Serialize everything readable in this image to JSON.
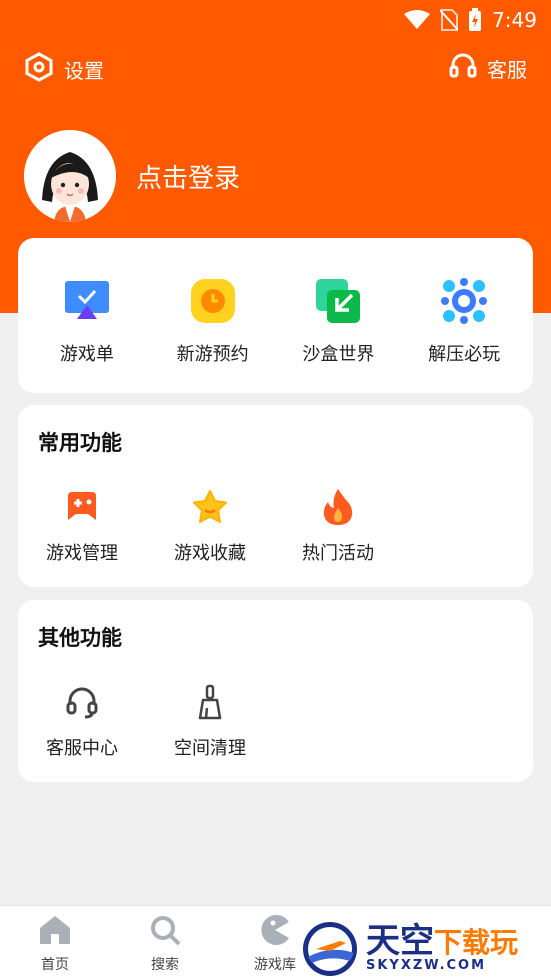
{
  "status_bar": {
    "time": "7:49"
  },
  "top": {
    "settings_label": "设置",
    "service_label": "客服"
  },
  "profile": {
    "login_label": "点击登录"
  },
  "quick_items": [
    {
      "label": "游戏单",
      "icon": "playlist-icon"
    },
    {
      "label": "新游预约",
      "icon": "clock-icon"
    },
    {
      "label": "沙盒世界",
      "icon": "sandbox-icon"
    },
    {
      "label": "解压必玩",
      "icon": "cluster-icon"
    }
  ],
  "common": {
    "title": "常用功能",
    "items": [
      {
        "label": "游戏管理",
        "icon": "gamepad-icon"
      },
      {
        "label": "游戏收藏",
        "icon": "star-icon"
      },
      {
        "label": "热门活动",
        "icon": "flame-icon"
      }
    ]
  },
  "other": {
    "title": "其他功能",
    "items": [
      {
        "label": "客服中心",
        "icon": "headset-icon"
      },
      {
        "label": "空间清理",
        "icon": "broom-icon"
      }
    ]
  },
  "nav": {
    "home": "首页",
    "search": "搜索",
    "library": "游戏库"
  },
  "watermark": {
    "cn_main": "天空",
    "cn_sub": "下载玩",
    "en": "SKYXZW.COM"
  },
  "colors": {
    "brand": "#ff5a00",
    "background": "#f0f0f0"
  }
}
